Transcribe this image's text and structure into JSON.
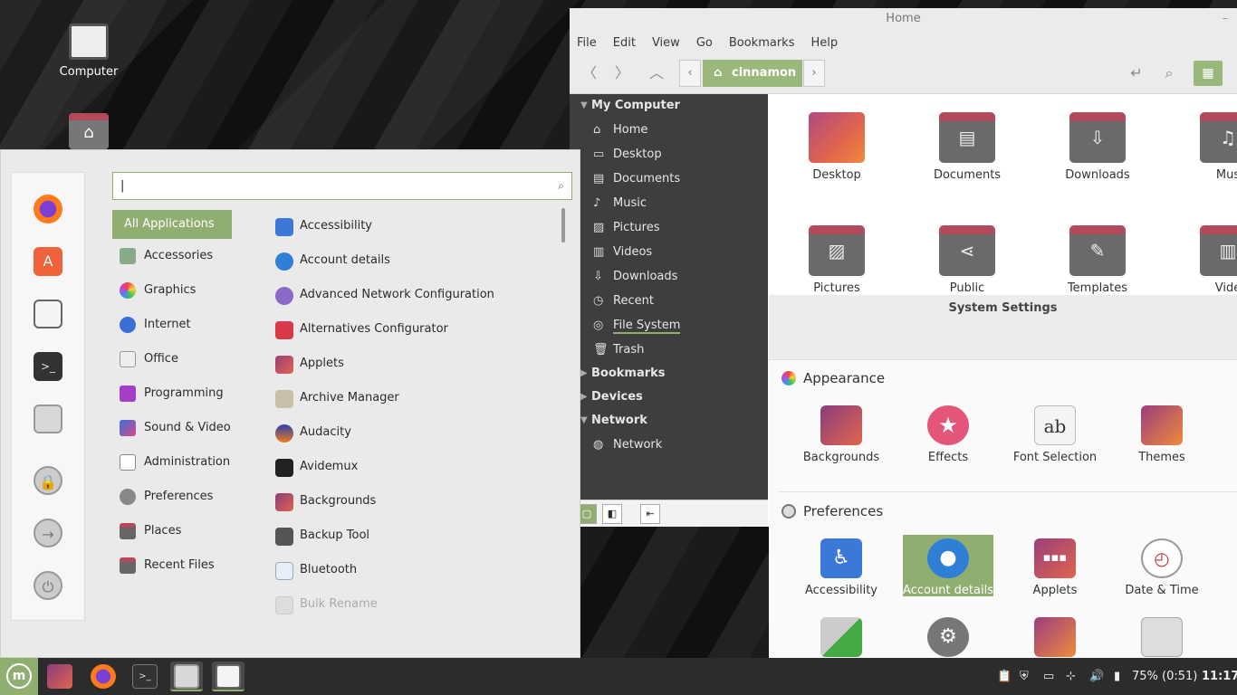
{
  "desktop": {
    "icons": [
      {
        "label": "Computer"
      },
      {
        "label": ""
      }
    ]
  },
  "file_manager": {
    "title": "Home",
    "menu": [
      "File",
      "Edit",
      "View",
      "Go",
      "Bookmarks",
      "Help"
    ],
    "breadcrumb": "cinnamon",
    "sidebar": {
      "my_computer": "My Computer",
      "items": [
        "Home",
        "Desktop",
        "Documents",
        "Music",
        "Pictures",
        "Videos",
        "Downloads",
        "Recent",
        "File System",
        "Trash"
      ],
      "bookmarks": "Bookmarks",
      "devices": "Devices",
      "network": "Network",
      "network_items": [
        "Network"
      ]
    },
    "folders": [
      "Desktop",
      "Documents",
      "Downloads",
      "Mus",
      "Pictures",
      "Public",
      "Templates",
      "Vide"
    ]
  },
  "system_settings": {
    "title": "System Settings",
    "appearance": {
      "heading": "Appearance",
      "items": [
        "Backgrounds",
        "Effects",
        "Font Selection",
        "Themes"
      ]
    },
    "preferences": {
      "heading": "Preferences",
      "items": [
        "Accessibility",
        "Account details",
        "Applets",
        "Date & Time"
      ]
    }
  },
  "start_menu": {
    "search": {
      "value": "|"
    },
    "categories": [
      "All Applications",
      "Accessories",
      "Graphics",
      "Internet",
      "Office",
      "Programming",
      "Sound & Video",
      "Administration",
      "Preferences",
      "Places",
      "Recent Files"
    ],
    "apps": [
      "Accessibility",
      "Account details",
      "Advanced Network Configuration",
      "Alternatives Configurator",
      "Applets",
      "Archive Manager",
      "Audacity",
      "Avidemux",
      "Backgrounds",
      "Backup Tool",
      "Bluetooth",
      "Bulk Rename"
    ]
  },
  "panel": {
    "battery": "75% (0:51)",
    "clock": "11:17"
  }
}
